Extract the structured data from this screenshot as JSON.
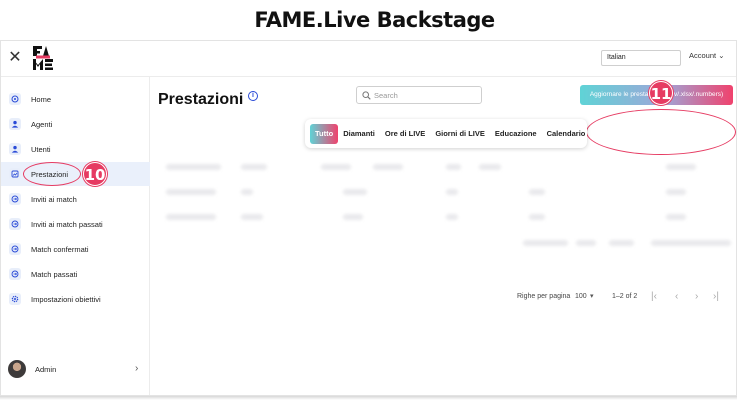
{
  "banner": {
    "title": "FAME.Live Backstage"
  },
  "topbar": {
    "close_label": "✕",
    "language": "Italian",
    "account_label": "Account",
    "account_chevron": "⌄"
  },
  "sidebar": {
    "items": [
      {
        "label": "Home",
        "icon": "home-icon"
      },
      {
        "label": "Agenti",
        "icon": "user-icon"
      },
      {
        "label": "Utenti",
        "icon": "user-icon"
      },
      {
        "label": "Prestazioni",
        "icon": "chart-icon"
      },
      {
        "label": "Inviti ai match",
        "icon": "match-icon"
      },
      {
        "label": "Inviti ai match passati",
        "icon": "match-icon"
      },
      {
        "label": "Match confermati",
        "icon": "match-icon"
      },
      {
        "label": "Match passati",
        "icon": "match-icon"
      },
      {
        "label": "Impostazioni obiettivi",
        "icon": "gear-icon"
      }
    ],
    "active_item": "Prestazioni",
    "user": {
      "name": "Admin",
      "chevron": "›"
    }
  },
  "main": {
    "title": "Prestazioni",
    "info_glyph": "i",
    "search": {
      "placeholder": "Search",
      "value": ""
    },
    "upload_button": "Aggiornare le prestazioni (.csv/.xlsx/.numbers)",
    "tabs": [
      "Tutto",
      "Diamanti",
      "Ore di LIVE",
      "Giorni di LIVE",
      "Educazione",
      "Calendario"
    ],
    "active_tab": "Tutto",
    "pagination": {
      "rows_per_page_label": "Righe per pagina",
      "rows_per_page": "100",
      "range": "1–2 of 2",
      "first": "|‹",
      "prev": "‹",
      "next": "›",
      "last": "›|"
    }
  },
  "callouts": {
    "step_10": "10",
    "step_11": "11"
  },
  "colors": {
    "accent_pink": "#e63b62",
    "gradient_start": "#5fd3d6",
    "gradient_end": "#f0426d",
    "active_nav_bg": "#eaf0fb"
  }
}
